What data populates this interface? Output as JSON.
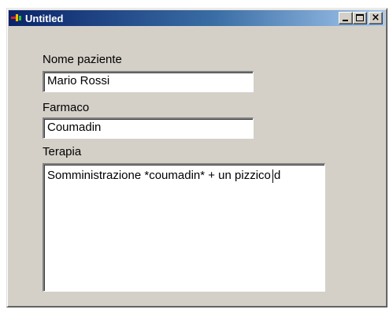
{
  "window": {
    "title": "Untitled",
    "close_glyph": "×"
  },
  "form": {
    "patient_label": "Nome paziente",
    "patient_value": "Mario Rossi",
    "drug_label": "Farmaco",
    "drug_value": "Coumadin",
    "therapy_label": "Terapia",
    "therapy_value": "Somministrazione *coumadin* + un pizzico d"
  },
  "colors": {
    "window_face": "#d4d0c8",
    "title_active_start": "#0a246a",
    "title_active_end": "#a6caf0"
  }
}
